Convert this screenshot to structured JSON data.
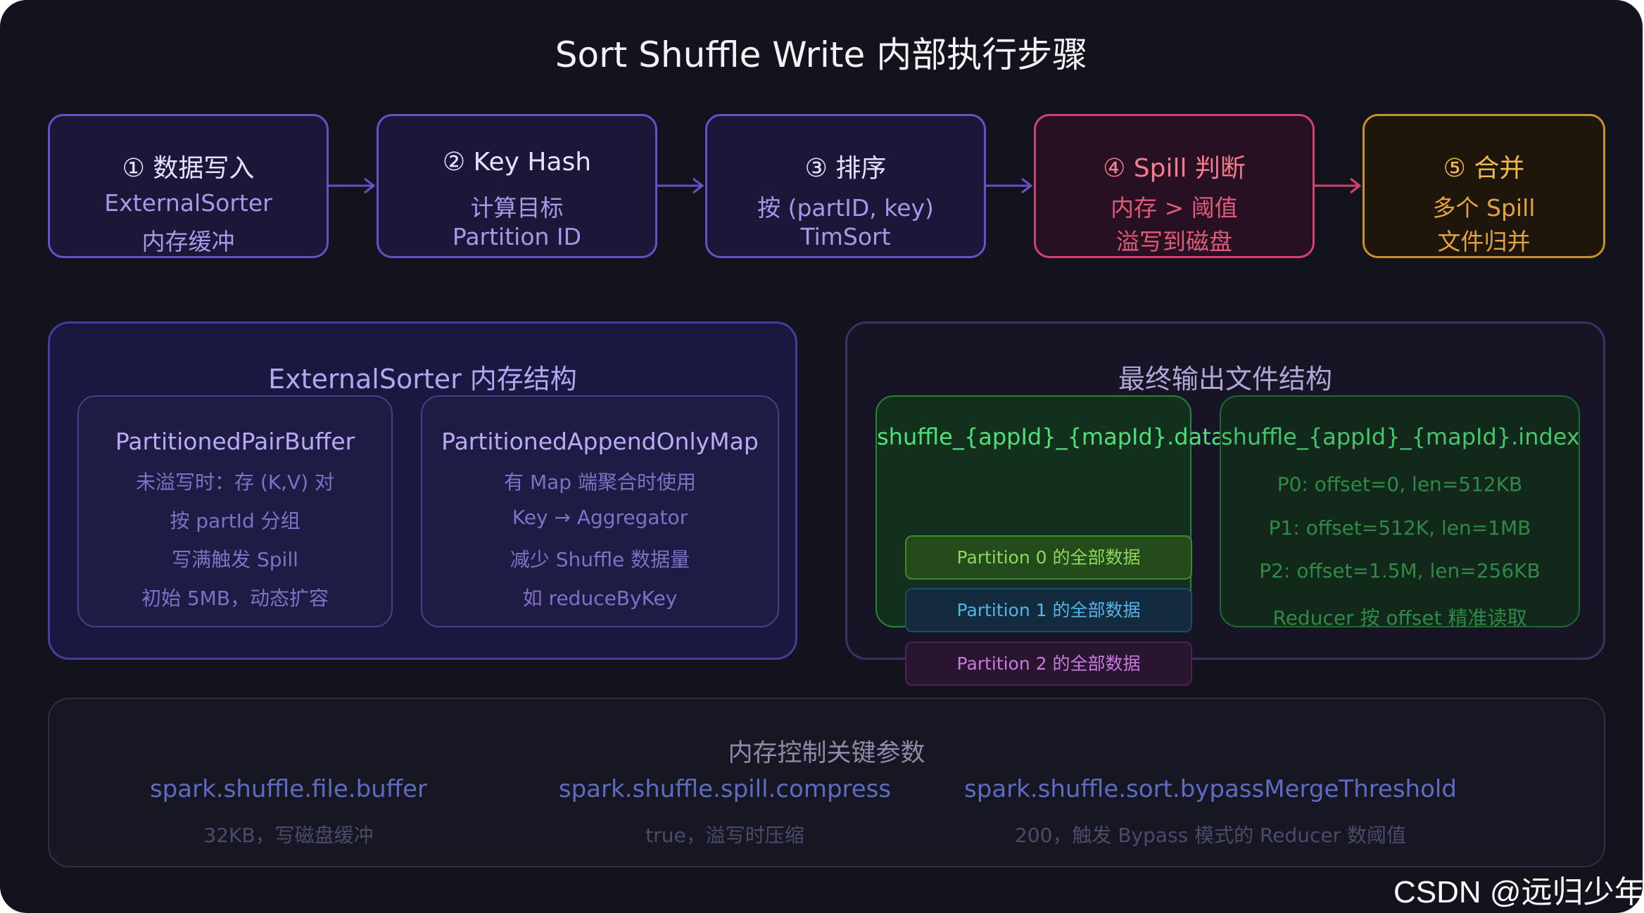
{
  "title": "Sort Shuffle Write 内部执行步骤",
  "steps": [
    {
      "title": "① 数据写入",
      "line1": "ExternalSorter",
      "line2": "内存缓冲"
    },
    {
      "title": "② Key Hash",
      "line1": "计算目标",
      "line2": "Partition ID"
    },
    {
      "title": "③ 排序",
      "line1": "按 (partID, key)",
      "line2": "TimSort"
    },
    {
      "title": "④ Spill 判断",
      "line1": "内存 > 阈值",
      "line2": "溢写到磁盘"
    },
    {
      "title": "⑤ 合并",
      "line1": "多个 Spill",
      "line2": "文件归并"
    }
  ],
  "memory_panel": {
    "title": "ExternalSorter 内存结构",
    "buffer": {
      "title": "PartitionedPairBuffer",
      "lines": [
        "未溢写时：存 (K,V) 对",
        "按 partId 分组",
        "写满触发 Spill",
        "初始 5MB，动态扩容"
      ]
    },
    "map": {
      "title": "PartitionedAppendOnlyMap",
      "lines": [
        "有 Map 端聚合时使用",
        "Key → Aggregator",
        "减少 Shuffle 数据量",
        "如 reduceByKey"
      ]
    }
  },
  "output_panel": {
    "title": "最终输出文件结构",
    "data_file": {
      "title": "shuffle_{appId}_{mapId}.data",
      "partitions": [
        "Partition 0 的全部数据",
        "Partition 1 的全部数据",
        "Partition 2 的全部数据"
      ]
    },
    "index_file": {
      "title": "shuffle_{appId}_{mapId}.index",
      "lines": [
        "P0: offset=0, len=512KB",
        "P1: offset=512K, len=1MB",
        "P2: offset=1.5M, len=256KB",
        "Reducer 按 offset 精准读取"
      ]
    }
  },
  "params_panel": {
    "title": "内存控制关键参数",
    "params": [
      {
        "name": "spark.shuffle.file.buffer",
        "desc": "32KB，写磁盘缓冲"
      },
      {
        "name": "spark.shuffle.spill.compress",
        "desc": "true，溢写时压缩"
      },
      {
        "name": "spark.shuffle.sort.bypassMergeThreshold",
        "desc": "200，触发 Bypass 模式的 Reducer 数阈值"
      }
    ]
  },
  "watermark": "CSDN @远归少年",
  "colors": {
    "background": "#13131d",
    "step_border": "#6b4fc8",
    "spill_border": "#d6416f",
    "merge_border": "#c8912a",
    "data_file_green": "#4fe07a"
  },
  "icons": [
    "arrow-right-icon"
  ]
}
